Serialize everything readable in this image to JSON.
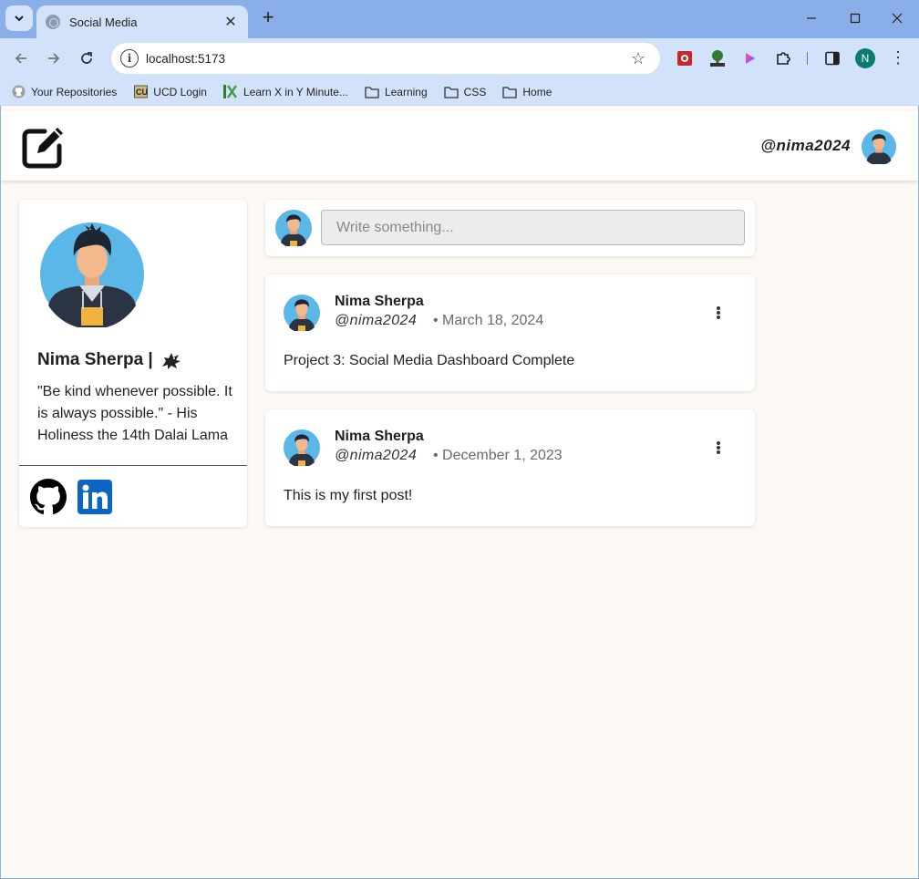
{
  "browser": {
    "tab_title": "Social Media",
    "url": "localhost:5173",
    "profile_initial": "N",
    "bookmarks": [
      {
        "label": "Your Repositories",
        "icon": "github-icon"
      },
      {
        "label": "UCD Login",
        "icon": "ucd-icon"
      },
      {
        "label": "Learn X in Y Minute...",
        "icon": "learnx-icon"
      },
      {
        "label": "Learning",
        "icon": "folder-icon"
      },
      {
        "label": "CSS",
        "icon": "folder-icon"
      },
      {
        "label": "Home",
        "icon": "folder-icon"
      }
    ]
  },
  "header": {
    "username": "@nima2024",
    "logo_icon": "edit-square-icon"
  },
  "profile": {
    "name": "Nima Sherpa |",
    "quote": "\"Be kind whenever possible. It is always possible.\" - His Holiness the 14th Dalai Lama",
    "links": [
      {
        "name": "github-icon"
      },
      {
        "name": "linkedin-icon",
        "color": "#0a66c2"
      }
    ]
  },
  "composer": {
    "placeholder": "Write something..."
  },
  "posts": [
    {
      "author": "Nima Sherpa",
      "handle": "@nima2024",
      "date": "• March 18, 2024",
      "body": "Project 3: Social Media Dashboard Complete"
    },
    {
      "author": "Nima Sherpa",
      "handle": "@nima2024",
      "date": "• December 1, 2023",
      "body": "This is my first post!"
    }
  ],
  "colors": {
    "page_background": "#fdf9f5",
    "avatar_background": "#5bb7e8",
    "browser_frame": "#8aaee8"
  }
}
